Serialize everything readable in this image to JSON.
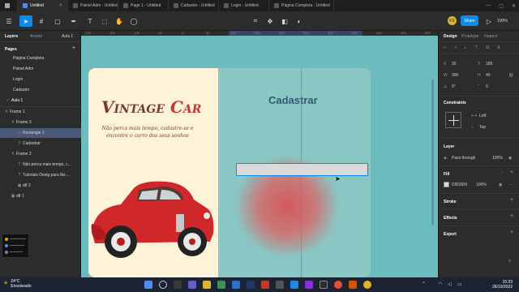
{
  "tabs": [
    {
      "label": "Untitled",
      "active": true
    },
    {
      "label": "Painel Adm - Untitled",
      "active": false
    },
    {
      "label": "Page 1 - Untitled",
      "active": false
    },
    {
      "label": "Cadastro - Untitled",
      "active": false
    },
    {
      "label": "Login - Untitled",
      "active": false
    },
    {
      "label": "Página Completa - Untitled",
      "active": false
    }
  ],
  "toolbar": {
    "share_label": "Share",
    "avatar_initials": "FS",
    "zoom": "100%"
  },
  "left_panel": {
    "tab_layers": "Layers",
    "tab_assets": "Assets",
    "page_selector": "Aula 1",
    "pages_title": "Pages",
    "pages": [
      "Página Completa",
      "Painel Adm",
      "Login",
      "Cadastro",
      "Aula 1"
    ],
    "layers": [
      {
        "label": "Frame 1",
        "icon": "#",
        "indent": 0
      },
      {
        "label": "Frame 3",
        "icon": "#",
        "indent": 1
      },
      {
        "label": "Rectangle 1",
        "icon": "▭",
        "indent": 2,
        "selected": true
      },
      {
        "label": "Cadastrar",
        "icon": "T",
        "indent": 2
      },
      {
        "label": "Frame 2",
        "icon": "#",
        "indent": 1
      },
      {
        "label": "Não perca mais tempo, c...",
        "icon": "T",
        "indent": 2
      },
      {
        "label": "Tutoriais Desig para No-...",
        "icon": "T",
        "indent": 2
      },
      {
        "label": "dtf 2",
        "icon": "▣",
        "indent": 2
      },
      {
        "label": "dtf 1",
        "icon": "▣",
        "indent": 1
      }
    ]
  },
  "ruler": {
    "ticks": [
      "-200",
      "-150",
      "-100",
      "-50",
      "0",
      "50",
      "100",
      "150",
      "200",
      "250",
      "300",
      "350",
      "400",
      "450",
      "500"
    ]
  },
  "canvas": {
    "brand_v": "V",
    "brand_intage": "INTAGE",
    "brand_c": "C",
    "brand_ar": "AR",
    "subtitle": "Não perca mais tempo, cadastre-se e encontre o carro dos seus sonhos",
    "heading": "Cadastrar"
  },
  "right_panel": {
    "tab_design": "Design",
    "tab_prototype": "Prototype",
    "tab_inspect": "Inspect",
    "x_label": "X",
    "x_value": "30",
    "y_label": "Y",
    "y_value": "189",
    "w_label": "W",
    "w_value": "390",
    "h_label": "H",
    "h_value": "40",
    "rotation": "0°",
    "radius": "0",
    "constraints_title": "Constraints",
    "constraint_h": "Left",
    "constraint_v": "Top",
    "layer_title": "Layer",
    "blend_mode": "Pass through",
    "layer_opacity": "100%",
    "fill_title": "Fill",
    "fill_hex": "D9D9D9",
    "fill_opacity": "100%",
    "fill_color": "#d9d9d9",
    "stroke_title": "Stroke",
    "effects_title": "Effects",
    "export_title": "Export"
  },
  "taskbar": {
    "temperature": "24°C",
    "weather": "Ensolarado",
    "time": "15:33",
    "date": "26/10/2022"
  }
}
